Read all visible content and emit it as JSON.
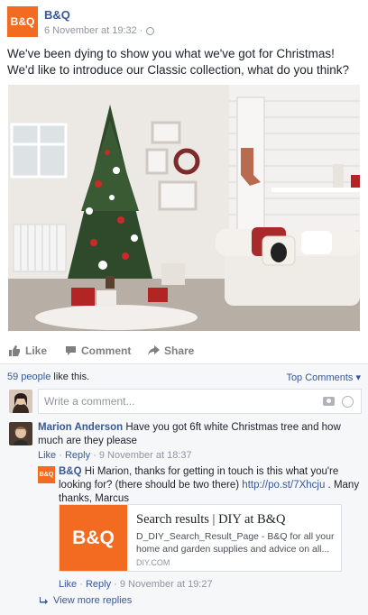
{
  "post": {
    "page_name": "B&Q",
    "logo_text": "B&Q",
    "timestamp": "6 November at 19:32 · ",
    "text": "We've been dying to show you what we've got for Christmas! We'd like to introduce our Classic collection, what do you think?"
  },
  "actions": {
    "like": "Like",
    "comment": "Comment",
    "share": "Share"
  },
  "feedback": {
    "likes_count": "59 people",
    "likes_suffix": " like this.",
    "top_comments": "Top Comments ▾",
    "composer_placeholder": "Write a comment..."
  },
  "comment": {
    "author": "Marion Anderson",
    "text": " Have you got 6ft white Christmas tree and how much are they please",
    "like": "Like",
    "reply": "Reply",
    "time": " · 9 November at 18:37"
  },
  "reply": {
    "logo_text": "B&Q",
    "author": "B&Q",
    "text_before": " Hi Marion, thanks for getting in touch is this what you're looking for? (there should be two there) ",
    "url": "http://po.st/7Xhcju",
    "text_after": " . Many thanks, Marcus",
    "like": "Like",
    "reply": "Reply",
    "time": " · 9 November at 19:27"
  },
  "link_preview": {
    "thumb_text": "B&Q",
    "title": "Search results | DIY at B&Q",
    "description": "D_DIY_Search_Result_Page - B&Q for all your home and garden supplies and advice on all...",
    "domain": "DIY.COM"
  },
  "view_more_replies": "View more replies",
  "colors": {
    "brand_orange": "#f26b21",
    "link_blue": "#365899",
    "muted_gray": "#90949c"
  }
}
